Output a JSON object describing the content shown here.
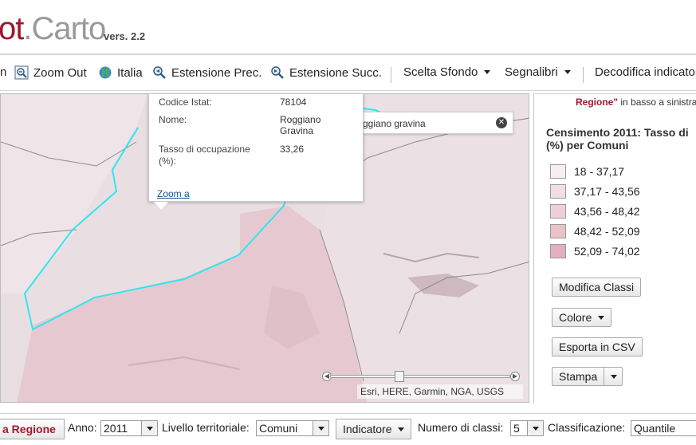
{
  "header": {
    "logo_part_a": "ot",
    "logo_part_b": ".Carto",
    "version": "vers. 2.2"
  },
  "toolbar": {
    "items": [
      {
        "label": "n",
        "icon": "zoom-in-icon"
      },
      {
        "label": "Zoom Out",
        "icon": "zoom-out-icon"
      },
      {
        "label": "Italia",
        "icon": "globe-icon"
      },
      {
        "label": "Estensione Prec.",
        "icon": "magnifier-prev-icon"
      },
      {
        "label": "Estensione Succ.",
        "icon": "magnifier-next-icon"
      }
    ],
    "dropdowns": [
      {
        "label": "Scelta Sfondo"
      },
      {
        "label": "Segnalibri"
      },
      {
        "label": "Decodifica indicator"
      }
    ]
  },
  "popup": {
    "rows": [
      {
        "key": "Codice Istat:",
        "value": "78104"
      },
      {
        "key": "Nome:",
        "value": "Roggiano Gravina"
      },
      {
        "key": "Tasso di occupazione (%):",
        "value": "33,26"
      }
    ],
    "zoom_link": "Zoom a"
  },
  "search": {
    "value": "ggiano gravina",
    "clear_icon": "close-circle-icon"
  },
  "map": {
    "attribution": "Esri, HERE, Garmin, NGA, USGS",
    "zoom_level": 0.38,
    "highlight_color": "#2ee6f0",
    "fill_color": "#e8c6cd"
  },
  "panel": {
    "note_bold": "Regione\"",
    "note_rest": " in basso a sinistra",
    "legend_title": "Censimento 2011: Tasso di (%) per Comuni",
    "legend": [
      {
        "label": "18 - 37,17",
        "color": "#f7eef0"
      },
      {
        "label": "37,17 - 43,56",
        "color": "#f3dde2"
      },
      {
        "label": "43,56 - 48,42",
        "color": "#efd0d7"
      },
      {
        "label": "48,42 - 52,09",
        "color": "#eac2cb"
      },
      {
        "label": "52,09 - 74,02",
        "color": "#e2b0bc"
      }
    ],
    "buttons": {
      "modifica": "Modifica Classi",
      "colore": "Colore",
      "esporta": "Esporta in CSV",
      "stampa": "Stampa"
    }
  },
  "bottombar": {
    "region_button": "a Regione",
    "anno_label": "Anno:",
    "anno_value": "2011",
    "livello_label": "Livello territoriale:",
    "livello_value": "Comuni",
    "indicatore_label": "Indicatore",
    "classi_label": "Numero di classi:",
    "classi_value": "5",
    "classificazione_label": "Classificazione:",
    "classificazione_value": "Quantile"
  },
  "colors": {
    "brand": "#a0172c",
    "link": "#1c4f8c"
  }
}
